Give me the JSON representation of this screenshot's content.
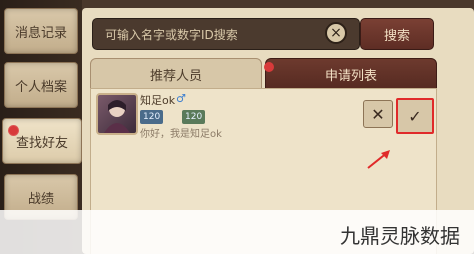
{
  "sidebar": {
    "items": [
      {
        "label": "消息记录"
      },
      {
        "label": "个人档案"
      },
      {
        "label": "查找好友"
      },
      {
        "label": "战绩"
      }
    ]
  },
  "search": {
    "placeholder": "可输入名字或数字ID搜索",
    "clear_icon": "×",
    "button_label": "搜索"
  },
  "tabs": [
    {
      "label": "推荐人员"
    },
    {
      "label": "申请列表"
    }
  ],
  "request": {
    "name": "知足ok",
    "gender_icon": "♂",
    "levels": [
      "120",
      "120"
    ],
    "message": "你好，我是知足ok",
    "reject_icon": "✕",
    "accept_icon": "✓"
  },
  "watermark": "九鼎灵脉数据"
}
